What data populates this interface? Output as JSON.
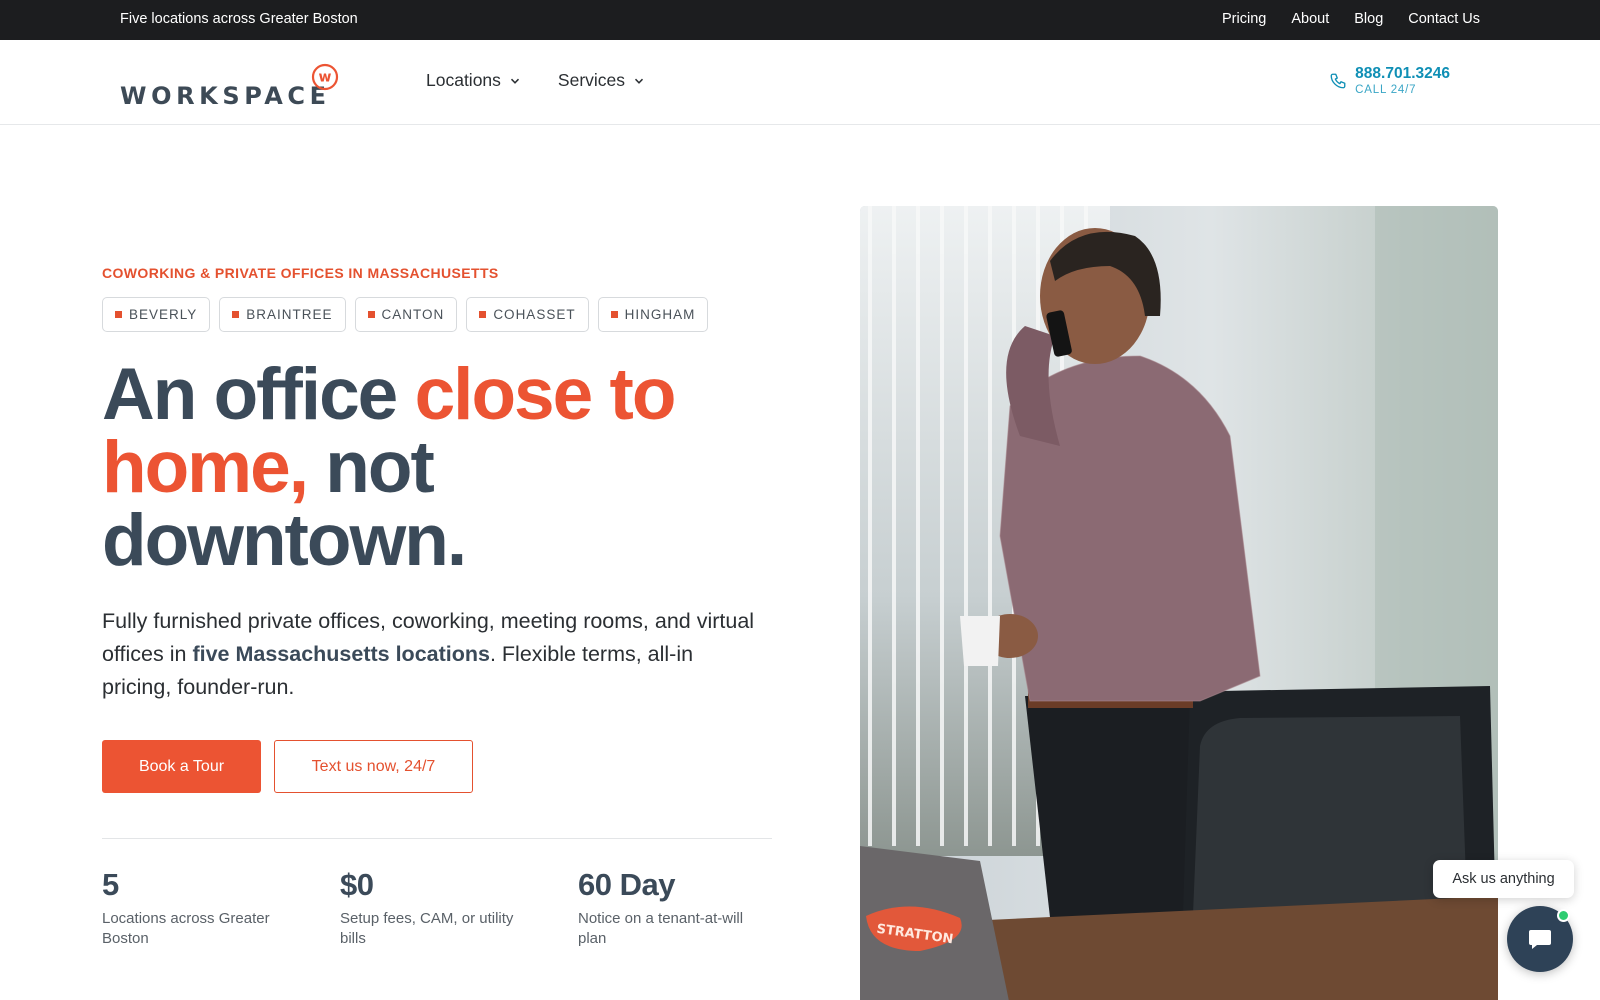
{
  "topbar": {
    "tagline": "Five locations across Greater Boston",
    "links": [
      "Pricing",
      "About",
      "Blog",
      "Contact Us"
    ]
  },
  "header": {
    "logo_text": "WORKSPACE",
    "logo_mark_letter": "w",
    "nav": [
      {
        "label": "Locations",
        "icon": "chevron-down-icon"
      },
      {
        "label": "Services",
        "icon": "chevron-down-icon"
      }
    ],
    "phone": {
      "number": "888.701.3246",
      "sub": "CALL 24/7",
      "icon": "phone-icon"
    }
  },
  "hero": {
    "eyebrow": "COWORKING & PRIVATE OFFICES IN MASSACHUSETTS",
    "locations": [
      "BEVERLY",
      "BRAINTREE",
      "CANTON",
      "COHASSET",
      "HINGHAM"
    ],
    "headline": {
      "part1": "An office ",
      "accent": "close to home,",
      "part2": " not downtown."
    },
    "lede": {
      "before": "Fully furnished private offices, coworking, meeting rooms, and virtual offices in ",
      "strong": "five Massachusetts locations",
      "after": ". Flexible terms, all-in pricing, founder-run."
    },
    "cta_primary": "Book a Tour",
    "cta_secondary": "Text us now, 24/7",
    "stats": [
      {
        "value": "5",
        "label": "Locations across Greater Boston"
      },
      {
        "value": "$0",
        "label": "Setup fees, CAM, or utility bills"
      },
      {
        "value": "60 Day",
        "label": "Notice on a tenant-at-will plan"
      }
    ],
    "photo_sticker": "STRATTON"
  },
  "chat": {
    "prompt": "Ask us anything",
    "icon": "chat-icon"
  },
  "colors": {
    "accent": "#ec5433",
    "navy": "#3b4a59",
    "phone_blue": "#0f8fb5",
    "topbar": "#1c1d1f"
  }
}
